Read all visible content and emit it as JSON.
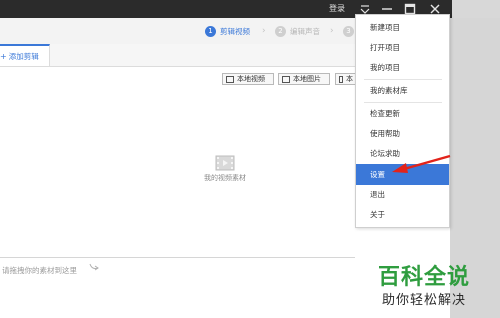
{
  "titlebar": {
    "login_label": "登录",
    "icons": [
      "dropdown-icon",
      "minimize-icon",
      "maximize-icon",
      "close-icon"
    ]
  },
  "steps": [
    {
      "num": "1",
      "label": "剪辑视频",
      "active": true
    },
    {
      "num": "2",
      "label": "编辑声音",
      "active": false
    },
    {
      "num": "3",
      "label": "",
      "active": false
    }
  ],
  "tab": {
    "label": "添加剪辑"
  },
  "toolbar": {
    "local_video_label": "本地视频",
    "local_image_label": "本地图片",
    "more_label": "本"
  },
  "placeholder": {
    "label": "我的视频素材"
  },
  "timeline": {
    "drag_hint": "请拖拽你的素材到这里"
  },
  "menu": {
    "items": [
      {
        "label": "新建项目"
      },
      {
        "label": "打开项目"
      },
      {
        "label": "我的项目"
      },
      {
        "label": "我的素材库"
      },
      {
        "label": "检查更新"
      },
      {
        "label": "使用帮助"
      },
      {
        "label": "论坛求助"
      },
      {
        "label": "设置",
        "highlighted": true
      },
      {
        "label": "退出"
      },
      {
        "label": "关于"
      }
    ]
  },
  "watermark": {
    "title": "百科全说",
    "subtitle": "助你轻松解决"
  },
  "colors": {
    "accent": "#3b78d8",
    "titlebar": "#2b2b2b",
    "arrow": "#e2231a",
    "watermark_green": "#2f9d3f"
  }
}
